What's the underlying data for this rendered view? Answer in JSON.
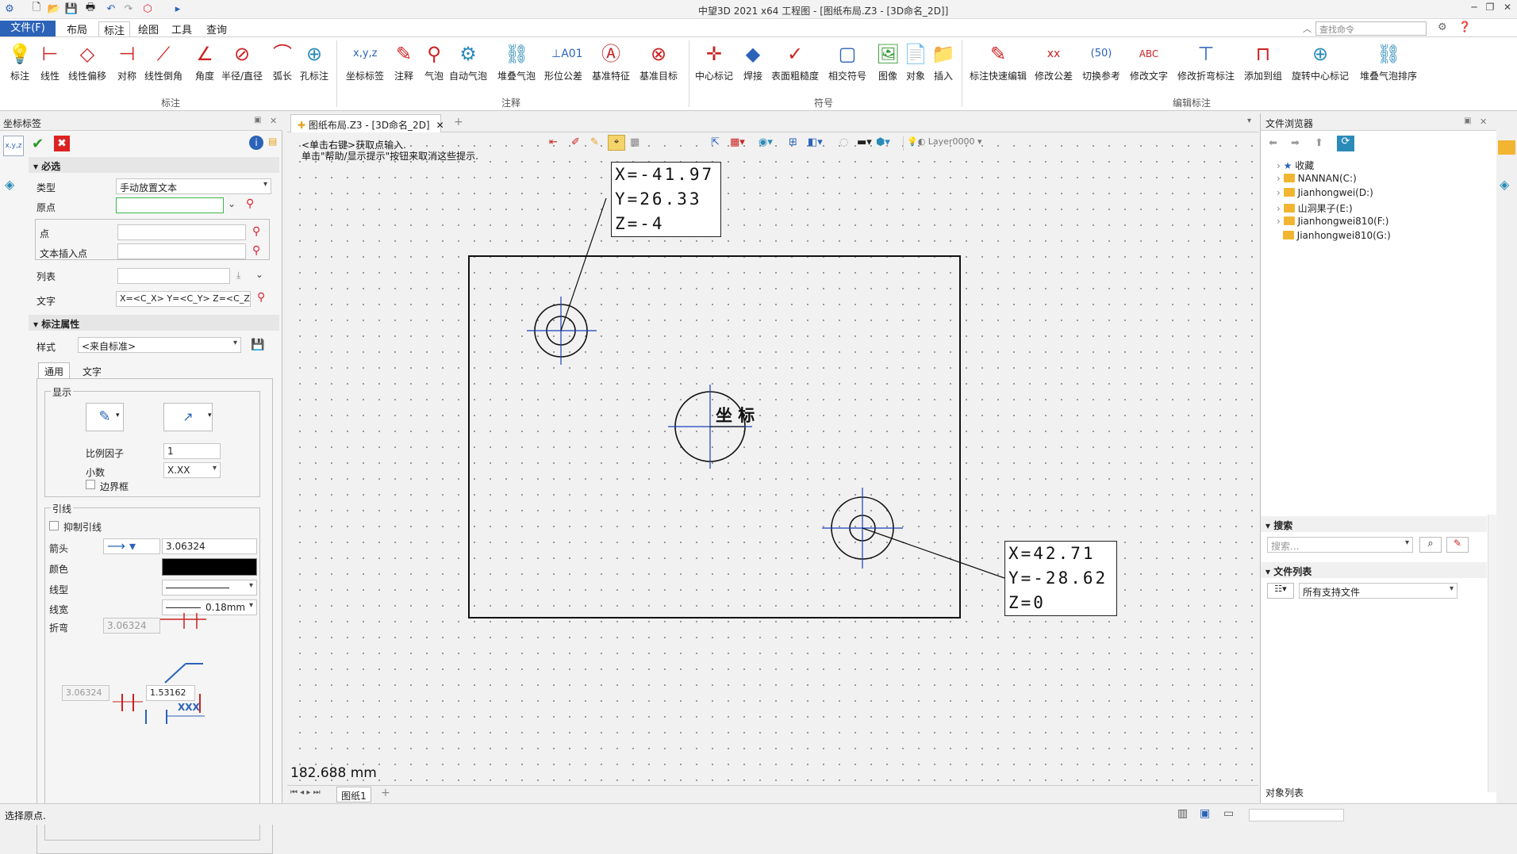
{
  "titlebar": {
    "title": "中望3D 2021 x64      工程图 - [图纸布局.Z3 - [3D命名_2D]]"
  },
  "menu": {
    "file": "文件(F)",
    "items": [
      "布局",
      "标注",
      "绘图",
      "工具",
      "查询"
    ],
    "search_placeholder": "查找命令"
  },
  "ribbon": {
    "buttons": [
      "标注",
      "线性",
      "线性偏移",
      "对称",
      "线性倒角",
      "角度",
      "半径/直径",
      "弧长",
      "孔标注",
      "坐标标签",
      "注释",
      "气泡",
      "自动气泡",
      "堆叠气泡",
      "形位公差",
      "基准特征",
      "基准目标",
      "中心标记",
      "焊接",
      "表面粗糙度",
      "相交符号",
      "图像",
      "对象",
      "插入",
      "标注快速编辑",
      "修改公差",
      "切换参考",
      "修改文字",
      "修改折弯标注",
      "添加到组",
      "旋转中心标记",
      "堆叠气泡排序"
    ],
    "groups": [
      "标注",
      "注释",
      "符号",
      "编辑标注"
    ]
  },
  "left_panel": {
    "title": "坐标标签",
    "required_header": "必选",
    "type_label": "类型",
    "type_value": "手动放置文本",
    "origin_label": "原点",
    "point_label": "点",
    "text_insert_label": "文本插入点",
    "list_label": "列表",
    "text_label": "文字",
    "text_value": "X=<C_X> Y=<C_Y> Z=<C_Z>",
    "props_header": "标注属性",
    "style_label": "样式",
    "style_value": "<来自标准>",
    "tab_general": "通用",
    "tab_text": "文字",
    "display_group": "显示",
    "scale_label": "比例因子",
    "scale_value": "1",
    "decimal_label": "小数",
    "decimal_value": "X.XX",
    "border_label": "边界框",
    "leader_group": "引线",
    "suppress_label": "抑制引线",
    "arrow_label": "箭头",
    "arrow_value": "3.06324",
    "color_label": "颜色",
    "linetype_label": "线型",
    "linewidth_label": "线宽",
    "linewidth_value": "0.18mm",
    "bend_label": "折弯",
    "bend_value": "3.06324",
    "dim_a": "3.06324",
    "dim_b": "1.53162",
    "xxx": "XXX"
  },
  "drawing": {
    "tab_title": "图纸布局.Z3 - [3D命名_2D]",
    "hint_line1": "<单击右键>获取点输入.",
    "hint_line2": "单击\"帮助/显示提示\"按钮来取消这些提示.",
    "layer": "Layer0000",
    "measure": "182.688 mm",
    "sheet_tab": "图纸1",
    "center_text": "坐 标",
    "label1": [
      "X=-41.97",
      "Y=26.33",
      "Z=-4"
    ],
    "label2": [
      "X=42.71",
      "Y=-28.62",
      "Z=0"
    ]
  },
  "right_panel": {
    "title": "文件浏览器",
    "tree": [
      "收藏",
      "NANNAN(C:)",
      "Jianhongwei(D:)",
      "山洞果子(E:)",
      "Jianhongwei810(F:)",
      "Jianhongwei810(G:)"
    ],
    "search_header": "搜索",
    "search_placeholder": "搜索...",
    "file_list_header": "文件列表",
    "file_filter": "所有支持文件",
    "object_list": "对象列表"
  },
  "status": {
    "text": "选择原点."
  },
  "colors": {
    "accent": "#2b63b8",
    "drawing_blue": "#1a3fb8",
    "line_black": "#111111"
  }
}
